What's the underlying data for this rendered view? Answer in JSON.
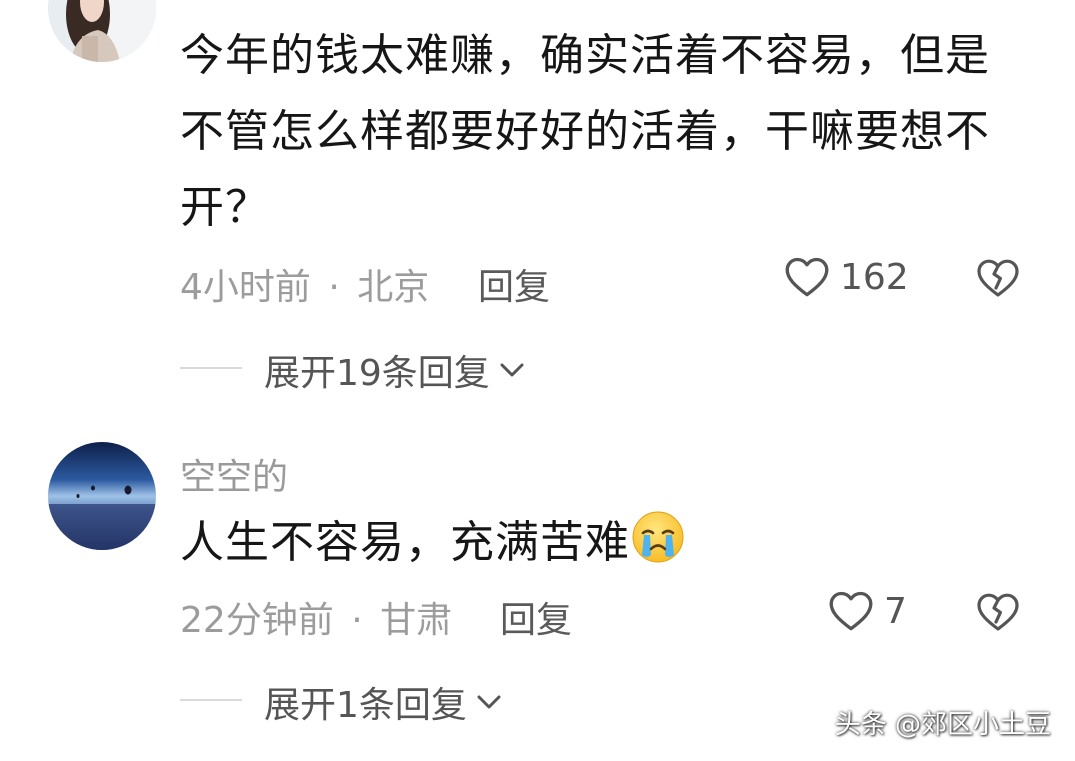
{
  "comments": [
    {
      "username": "",
      "text": "今年的钱太难赚，确实活着不容易，但是不管怎么样都要好好的活着，干嘛要想不开？",
      "time": "4小时前",
      "separator": "·",
      "location": "北京",
      "reply_label": "回复",
      "likes": "162",
      "expand_label": "展开19条回复"
    },
    {
      "username": "空空的",
      "text": "人生不容易，充满苦难",
      "emoji": "crying-face-icon",
      "time": "22分钟前",
      "separator": "·",
      "location": "甘肃",
      "reply_label": "回复",
      "likes": "7",
      "expand_label": "展开1条回复"
    }
  ],
  "watermark": "头条 @郊区小土豆",
  "colors": {
    "text": "#161616",
    "meta": "#9c9c9c",
    "action": "#555555",
    "divider": "#dadada"
  }
}
